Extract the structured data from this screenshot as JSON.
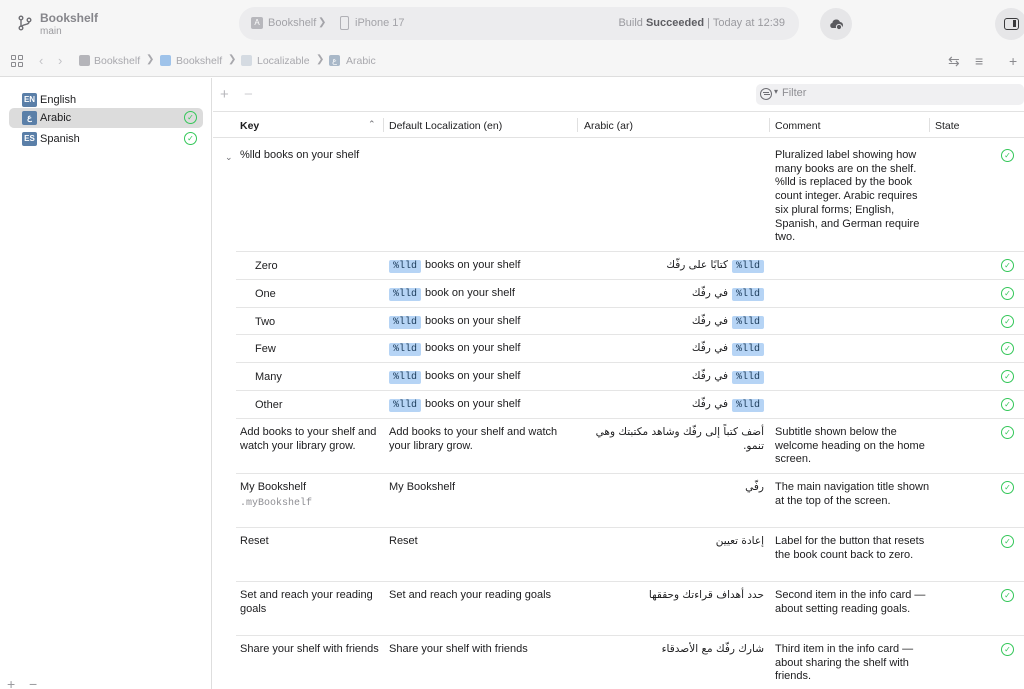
{
  "window": {
    "project_name": "Bookshelf",
    "branch": "main",
    "activity": {
      "scheme": "Bookshelf",
      "device": "iPhone 17",
      "status_prefix": "Build ",
      "status_bold": "Succeeded",
      "status_suffix": " | Today at 12:39"
    }
  },
  "jumpbar": {
    "crumbs": [
      "Bookshelf",
      "Bookshelf",
      "Localizable",
      "Arabic"
    ]
  },
  "sidebar": {
    "languages": [
      {
        "code": "EN",
        "name": "English",
        "selected": false,
        "complete": false
      },
      {
        "code": "ع",
        "name": "Arabic",
        "selected": true,
        "complete": true
      },
      {
        "code": "ES",
        "name": "Spanish",
        "selected": false,
        "complete": true
      }
    ]
  },
  "editor": {
    "filter_placeholder": "Filter",
    "columns": {
      "key": "Key",
      "default": "Default Localization (en)",
      "arabic": "Arabic (ar)",
      "comment": "Comment",
      "state": "State"
    },
    "plural_group": {
      "key": "%lld books on your shelf",
      "comment": "Pluralized label showing how many books are on the shelf. %lld is replaced by the book count integer. Arabic requires six plural forms; English, Spanish, and German require two.",
      "token": "%lld",
      "variants": [
        {
          "key": "Zero",
          "en_text": "books on your shelf",
          "ar_text": "كتابًا على رفّك"
        },
        {
          "key": "One",
          "en_text": "book on your shelf",
          "ar_text": "في رفّك"
        },
        {
          "key": "Two",
          "en_text": "books on your shelf",
          "ar_text": "في رفّك"
        },
        {
          "key": "Few",
          "en_text": "books on your shelf",
          "ar_text": "في رفّك"
        },
        {
          "key": "Many",
          "en_text": "books on your shelf",
          "ar_text": "في رفّك"
        },
        {
          "key": "Other",
          "en_text": "books on your shelf",
          "ar_text": "في رفّك"
        }
      ]
    },
    "rows": [
      {
        "key": "Add books to your shelf and watch your library grow.",
        "key_id": "",
        "default": "Add books to your shelf and watch your library grow.",
        "arabic": "أضف كتباً إلى رفّك وشاهد مكتبتك وهي تنمو.",
        "comment": "Subtitle shown below the welcome heading on the home screen."
      },
      {
        "key": "My Bookshelf",
        "key_id": ".myBookshelf",
        "default": "My Bookshelf",
        "arabic": "رفّي",
        "comment": "The main navigation title shown at the top of the screen."
      },
      {
        "key": "Reset",
        "key_id": "",
        "default": "Reset",
        "arabic": "إعادة تعيين",
        "comment": "Label for the button that resets the book count back to zero."
      },
      {
        "key": "Set and reach your reading goals",
        "key_id": "",
        "default": "Set and reach your reading goals",
        "arabic": "حدد أهداف قراءتك وحققها",
        "comment": "Second item in the info card — about setting reading goals."
      },
      {
        "key": "Share your shelf with friends",
        "key_id": "",
        "default": "Share your shelf with friends",
        "arabic": "شارك رفّك مع الأصدقاء",
        "comment": "Third item in the info card — about sharing the shelf with friends."
      }
    ]
  },
  "colors": {
    "accent_green": "#34c759",
    "token_blue": "#b6d4f5",
    "selection_gray": "#dcdcdc",
    "lang_badge": "#5a7fa8"
  }
}
